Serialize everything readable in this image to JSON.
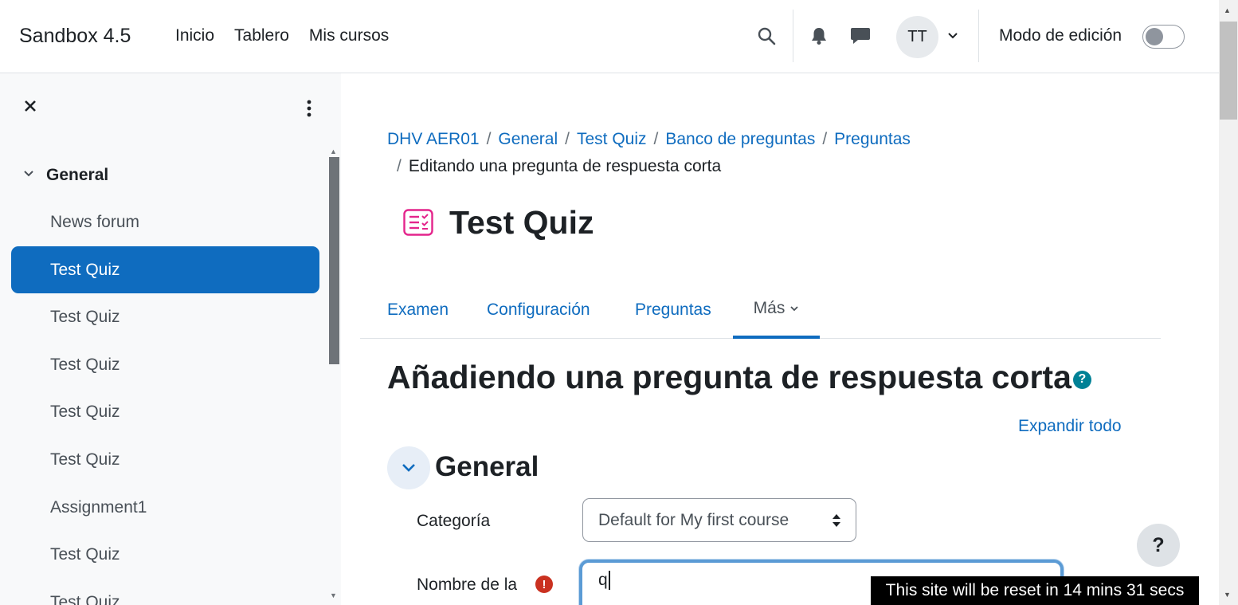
{
  "navbar": {
    "brand": "Sandbox 4.5",
    "links": [
      "Inicio",
      "Tablero",
      "Mis cursos"
    ],
    "avatar_initials": "TT",
    "edit_mode_label": "Modo de edición",
    "edit_mode_on": false
  },
  "drawer": {
    "section_title": "General",
    "items": [
      {
        "label": "News forum",
        "active": false
      },
      {
        "label": "Test Quiz",
        "active": true
      },
      {
        "label": "Test Quiz",
        "active": false
      },
      {
        "label": "Test Quiz",
        "active": false
      },
      {
        "label": "Test Quiz",
        "active": false
      },
      {
        "label": "Test Quiz",
        "active": false
      },
      {
        "label": "Assignment1",
        "active": false
      },
      {
        "label": "Test Quiz",
        "active": false
      },
      {
        "label": "Test Quiz",
        "active": false
      }
    ]
  },
  "breadcrumb": {
    "links": [
      "DHV AER01",
      "General",
      "Test Quiz",
      "Banco de preguntas",
      "Preguntas"
    ],
    "current": "Editando una pregunta de respuesta corta"
  },
  "page": {
    "title": "Test Quiz",
    "heading": "Añadiendo una pregunta de respuesta corta",
    "help_glyph": "?",
    "expand_all": "Expandir todo"
  },
  "tabs": [
    {
      "label": "Examen",
      "active": false
    },
    {
      "label": "Configuración",
      "active": false
    },
    {
      "label": "Preguntas",
      "active": false
    },
    {
      "label": "Más",
      "active": true
    }
  ],
  "form": {
    "section_title": "General",
    "category_label": "Categoría",
    "category_value": "Default for My first course",
    "name_label": "Nombre de la",
    "required_glyph": "!",
    "name_value": "q"
  },
  "help_button": "?",
  "reset_banner": "This site will be reset in 14 mins 31 secs",
  "colors": {
    "primary": "#0f6cbf",
    "drawer_bg": "#f8f9fa",
    "quiz_icon": "#e4258c",
    "required": "#ca3120",
    "help": "#008196"
  }
}
